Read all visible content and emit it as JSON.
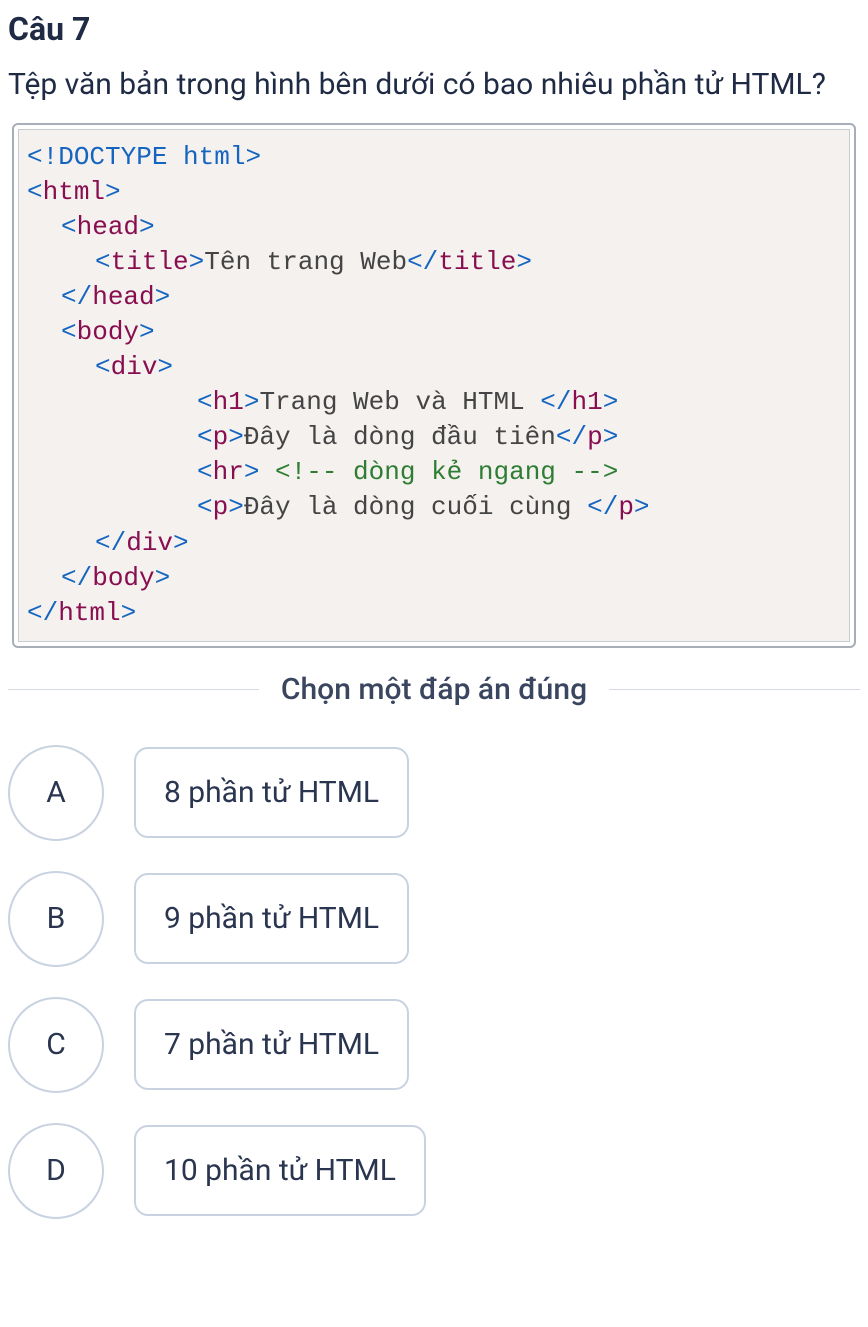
{
  "question": {
    "number_label": "Câu 7",
    "text": "Tệp văn bản trong hình bên dưới có bao nhiêu phần tử HTML?"
  },
  "code": {
    "lines": [
      {
        "indent": "",
        "tokens": [
          {
            "t": "ang",
            "v": "<!"
          },
          {
            "t": "doctype",
            "v": "DOCTYPE html"
          },
          {
            "t": "ang",
            "v": ">"
          }
        ]
      },
      {
        "indent": "",
        "tokens": [
          {
            "t": "ang",
            "v": "<"
          },
          {
            "t": "name",
            "v": "html"
          },
          {
            "t": "ang",
            "v": ">"
          }
        ]
      },
      {
        "indent": "ind1",
        "tokens": [
          {
            "t": "ang",
            "v": "<"
          },
          {
            "t": "name",
            "v": "head"
          },
          {
            "t": "ang",
            "v": ">"
          }
        ]
      },
      {
        "indent": "ind2",
        "tokens": [
          {
            "t": "ang",
            "v": "<"
          },
          {
            "t": "name",
            "v": "title"
          },
          {
            "t": "ang",
            "v": ">"
          },
          {
            "t": "text",
            "v": "Tên trang Web"
          },
          {
            "t": "ang",
            "v": "</"
          },
          {
            "t": "name",
            "v": "title"
          },
          {
            "t": "ang",
            "v": ">"
          }
        ]
      },
      {
        "indent": "ind1",
        "tokens": [
          {
            "t": "ang",
            "v": "</"
          },
          {
            "t": "name",
            "v": "head"
          },
          {
            "t": "ang",
            "v": ">"
          }
        ]
      },
      {
        "indent": "ind1",
        "tokens": [
          {
            "t": "ang",
            "v": "<"
          },
          {
            "t": "name",
            "v": "body"
          },
          {
            "t": "ang",
            "v": ">"
          }
        ]
      },
      {
        "indent": "ind2",
        "tokens": [
          {
            "t": "ang",
            "v": "<"
          },
          {
            "t": "name",
            "v": "div"
          },
          {
            "t": "ang",
            "v": ">"
          }
        ]
      },
      {
        "indent": "ind3",
        "tokens": [
          {
            "t": "ang",
            "v": "<"
          },
          {
            "t": "name",
            "v": "h1"
          },
          {
            "t": "ang",
            "v": ">"
          },
          {
            "t": "text",
            "v": "Trang Web và HTML "
          },
          {
            "t": "ang",
            "v": "</"
          },
          {
            "t": "name",
            "v": "h1"
          },
          {
            "t": "ang",
            "v": ">"
          }
        ]
      },
      {
        "indent": "ind3",
        "tokens": [
          {
            "t": "ang",
            "v": "<"
          },
          {
            "t": "name",
            "v": "p"
          },
          {
            "t": "ang",
            "v": ">"
          },
          {
            "t": "text",
            "v": "Đây là dòng đầu tiên"
          },
          {
            "t": "ang",
            "v": "</"
          },
          {
            "t": "name",
            "v": "p"
          },
          {
            "t": "ang",
            "v": ">"
          }
        ]
      },
      {
        "indent": "ind3",
        "tokens": [
          {
            "t": "ang",
            "v": "<"
          },
          {
            "t": "name",
            "v": "hr"
          },
          {
            "t": "ang",
            "v": ">"
          },
          {
            "t": "text",
            "v": " "
          },
          {
            "t": "comment",
            "v": "<!-- dòng kẻ ngang -->"
          }
        ]
      },
      {
        "indent": "ind3",
        "tokens": [
          {
            "t": "ang",
            "v": "<"
          },
          {
            "t": "name",
            "v": "p"
          },
          {
            "t": "ang",
            "v": ">"
          },
          {
            "t": "text",
            "v": "Đây là dòng cuối cùng "
          },
          {
            "t": "ang",
            "v": "</"
          },
          {
            "t": "name",
            "v": "p"
          },
          {
            "t": "ang",
            "v": ">"
          }
        ]
      },
      {
        "indent": "ind2",
        "tokens": [
          {
            "t": "ang",
            "v": "</"
          },
          {
            "t": "name",
            "v": "div"
          },
          {
            "t": "ang",
            "v": ">"
          }
        ]
      },
      {
        "indent": "ind1",
        "tokens": [
          {
            "t": "ang",
            "v": "</"
          },
          {
            "t": "name",
            "v": "body"
          },
          {
            "t": "ang",
            "v": ">"
          }
        ]
      },
      {
        "indent": "",
        "tokens": [
          {
            "t": "ang",
            "v": "</"
          },
          {
            "t": "name",
            "v": "html"
          },
          {
            "t": "ang",
            "v": ">"
          }
        ]
      }
    ]
  },
  "instruction": "Chọn một đáp án đúng",
  "options": [
    {
      "letter": "A",
      "text": "8 phần tử HTML"
    },
    {
      "letter": "B",
      "text": "9 phần tử HTML"
    },
    {
      "letter": "C",
      "text": "7 phần tử HTML"
    },
    {
      "letter": "D",
      "text": "10 phần tử HTML"
    }
  ]
}
